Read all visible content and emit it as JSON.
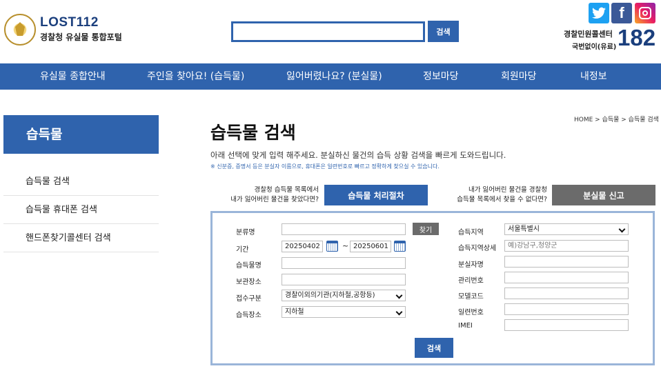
{
  "header": {
    "brand_title": "LOST112",
    "brand_subtitle": "경찰청 유실물 통합포털",
    "search_button": "검색",
    "call_center_label": "경찰민원콜센터",
    "call_center_note": "국번없이(유료)",
    "call_center_number": "182",
    "social": [
      "twitter-icon",
      "facebook-icon",
      "instagram-icon"
    ]
  },
  "nav": {
    "items": [
      "유실물 종합안내",
      "주인을 찾아요! (습득물)",
      "잃어버렸나요? (분실물)",
      "정보마당",
      "회원마당",
      "내정보"
    ]
  },
  "sidebar": {
    "title": "습득물",
    "items": [
      "습득물 검색",
      "습득물 휴대폰 검색",
      "핸드폰찾기콜센터 검색"
    ]
  },
  "main": {
    "breadcrumb": "HOME > 습득물 > 습득물 검색",
    "title": "습득물 검색",
    "description": "아래 선택에 맞게 입력 해주세요. 분실하신 물건의 습득 상황 검색을 빠르게 도와드립니다.",
    "note": "※ 신분증, 증명서 등은 분실자 이름으로, 휴대폰은 일련번호로 빠르고 정확하게 찾으실 수 있습니다.",
    "cta_left_text_1": "경찰청 습득물 목록에서",
    "cta_left_text_2": "내가 잃어버린 물건을 찾았다면?",
    "cta_left_button": "습득물 처리절차",
    "cta_right_text_1": "내가 잃어버린 물건을 경찰청",
    "cta_right_text_2": "습득물 목록에서 찾을 수 없다면?",
    "cta_right_button": "분실물 신고"
  },
  "form": {
    "category_label": "분류명",
    "category_value": "",
    "find_button": "찾기",
    "period_label": "기간",
    "date_from": "20250402",
    "date_sep": "~",
    "date_to": "20250601",
    "item_name_label": "습득물명",
    "item_name_value": "",
    "storage_label": "보관장소",
    "storage_value": "",
    "intake_label": "접수구분",
    "intake_value": "경찰이외의기관(지하철,공항등)",
    "place_label": "습득장소",
    "place_value": "지하철",
    "region_label": "습득지역",
    "region_value": "서울특별시",
    "region_detail_label": "습득지역상세",
    "region_detail_placeholder": "예)강남구,청양군",
    "owner_label": "분실자명",
    "owner_value": "",
    "mgmt_label": "관리번호",
    "mgmt_value": "",
    "model_label": "모델코드",
    "model_value": "",
    "serial_label": "일련번호",
    "serial_value": "",
    "imei_label": "IMEI",
    "imei_value": "",
    "submit_button": "검색"
  },
  "colors": {
    "primary": "#2f63ad",
    "gray_button": "#6b6b6b",
    "panel_border": "#9ab5d9"
  }
}
